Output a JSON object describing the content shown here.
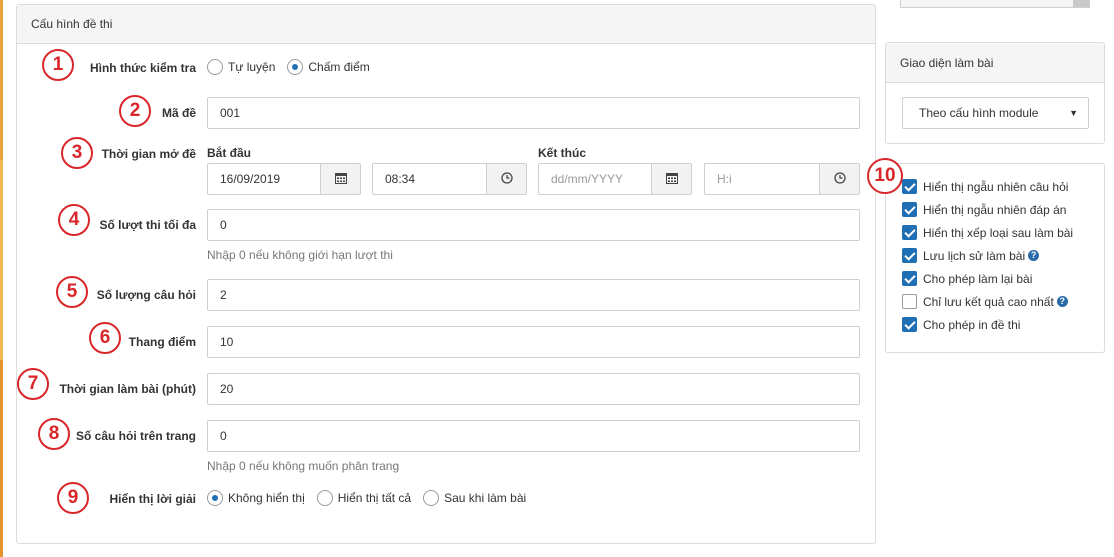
{
  "config_panel": {
    "title": "Cấu hình đề thi",
    "exam_mode": {
      "number": "1",
      "label": "Hình thức kiểm tra",
      "options": [
        "Tự luyện",
        "Chấm điểm"
      ],
      "selected": "Chấm điểm"
    },
    "exam_code": {
      "number": "2",
      "label": "Mã đề",
      "value": "001"
    },
    "open_time": {
      "number": "3",
      "label": "Thời gian mở đề",
      "start_label": "Bắt đầu",
      "start_date": "16/09/2019",
      "start_time": "08:34",
      "end_label": "Kết thúc",
      "end_date_placeholder": "dd/mm/YYYY",
      "end_time_placeholder": "H:i"
    },
    "max_attempts": {
      "number": "4",
      "label": "Số lượt thi tối đa",
      "value": "0",
      "help": "Nhập 0 nếu không giới hạn lượt thi"
    },
    "question_count": {
      "number": "5",
      "label": "Số lượng câu hỏi",
      "value": "2"
    },
    "score_scale": {
      "number": "6",
      "label": "Thang điểm",
      "value": "10"
    },
    "duration": {
      "number": "7",
      "label": "Thời gian làm bài (phút)",
      "value": "20"
    },
    "questions_per_page": {
      "number": "8",
      "label": "Số câu hỏi trên trang",
      "value": "0",
      "help": "Nhập 0 nếu không muốn phân trang"
    },
    "show_solution": {
      "number": "9",
      "label": "Hiển thị lời giải",
      "options": [
        "Không hiển thị",
        "Hiển thị tất cả",
        "Sau khi làm bài"
      ],
      "selected": "Không hiển thị"
    }
  },
  "sidebar": {
    "interface_panel": {
      "title": "Giao diện làm bài",
      "select_value": "Theo cấu hình module"
    },
    "options_number": "10",
    "options": [
      {
        "label": "Hiển thị ngẫu nhiên câu hỏi",
        "checked": true,
        "help": false
      },
      {
        "label": "Hiển thị ngẫu nhiên đáp án",
        "checked": true,
        "help": false
      },
      {
        "label": "Hiển thị xếp loại sau làm bài",
        "checked": true,
        "help": false
      },
      {
        "label": "Lưu lịch sử làm bài",
        "checked": true,
        "help": true
      },
      {
        "label": "Cho phép làm lại bài",
        "checked": true,
        "help": false
      },
      {
        "label": "Chỉ lưu kết quả cao nhất",
        "checked": false,
        "help": true
      },
      {
        "label": "Cho phép in đề thi",
        "checked": true,
        "help": false
      }
    ]
  },
  "icons": {
    "calendar": "calendar-icon",
    "clock": "clock-icon",
    "help": "question-circle-icon",
    "caret": "caret-down-icon"
  },
  "colors": {
    "annotation_red": "#d9262b",
    "accent_blue": "#1f6fb5",
    "left_strip": [
      "#e8a33d",
      "#f0b851",
      "#e7952b"
    ]
  }
}
